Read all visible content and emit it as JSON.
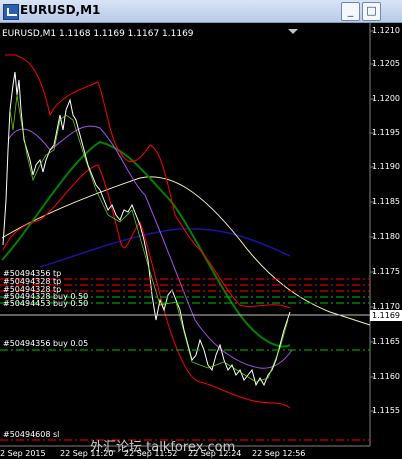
{
  "window": {
    "title": "EURUSD,M1",
    "buttons": [
      "_",
      "□"
    ]
  },
  "chart": {
    "header": "EURUSD,M1  1.1168 1.1169 1.1167 1.1169",
    "current_price": "1.1169",
    "price_labels": [
      "1.1210",
      "1.1205",
      "1.1200",
      "1.1195",
      "1.1190",
      "1.1185",
      "1.1180",
      "1.1175",
      "1.1170",
      "1.1165",
      "1.1160",
      "1.1155"
    ],
    "time_labels": [
      "2 Sep 2015",
      "22 Sep 11:20",
      "22 Sep 11:52",
      "22 Sep 12:24",
      "22 Sep 12:56"
    ],
    "orders": [
      {
        "label": "#50494356 tp"
      },
      {
        "label": "#50494328 tp"
      },
      {
        "label": "#50494328 tp"
      },
      {
        "label": "#50494328 buy 0.50"
      },
      {
        "label": "#50494453 buy 0.50"
      },
      {
        "label": "#50494356 buy 0.05"
      },
      {
        "label": "#50494608 sl"
      }
    ],
    "watermark": "外汇论坛 talkforex.com",
    "colors": {
      "background": "#000000",
      "price_line": "#ffffff",
      "bollinger": "#ff0000",
      "ma_green": "#008000",
      "ma_blue": "#1515a0",
      "ma_yellow": "#f5f0b0",
      "ma_violet": "#a050e0",
      "ma_lime": "#7cfc00",
      "tp_line": "#ff0000",
      "buy_line": "#00c000"
    }
  }
}
